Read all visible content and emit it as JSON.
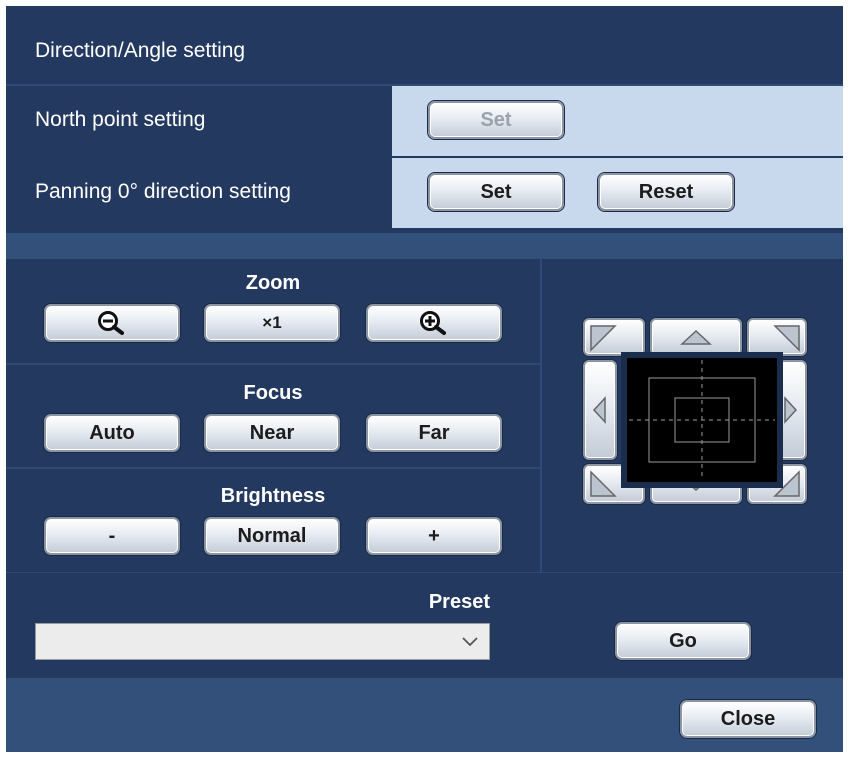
{
  "dialog": {
    "title": "Direction/Angle setting",
    "north_point": {
      "label": "North point setting",
      "set_label": "Set"
    },
    "panning": {
      "label": "Panning 0° direction setting",
      "set_label": "Set",
      "reset_label": "Reset"
    }
  },
  "camera": {
    "zoom": {
      "label": "Zoom",
      "zoom_out_icon": "zoom-out-icon",
      "reset_label": "×1",
      "zoom_in_icon": "zoom-in-icon"
    },
    "focus": {
      "label": "Focus",
      "auto_label": "Auto",
      "near_label": "Near",
      "far_label": "Far"
    },
    "brightness": {
      "label": "Brightness",
      "minus_label": "-",
      "normal_label": "Normal",
      "plus_label": "+"
    },
    "pan_tilt_icons": [
      "up-left-icon",
      "up-icon",
      "up-right-icon",
      "left-icon",
      "right-icon",
      "down-left-icon",
      "down-icon",
      "down-right-icon"
    ]
  },
  "preset": {
    "label": "Preset",
    "selected": "",
    "go_label": "Go"
  },
  "footer": {
    "close_label": "Close"
  },
  "colors": {
    "panel": "#23395f",
    "band": "#33507a",
    "value_bg": "#c8d9ee"
  }
}
